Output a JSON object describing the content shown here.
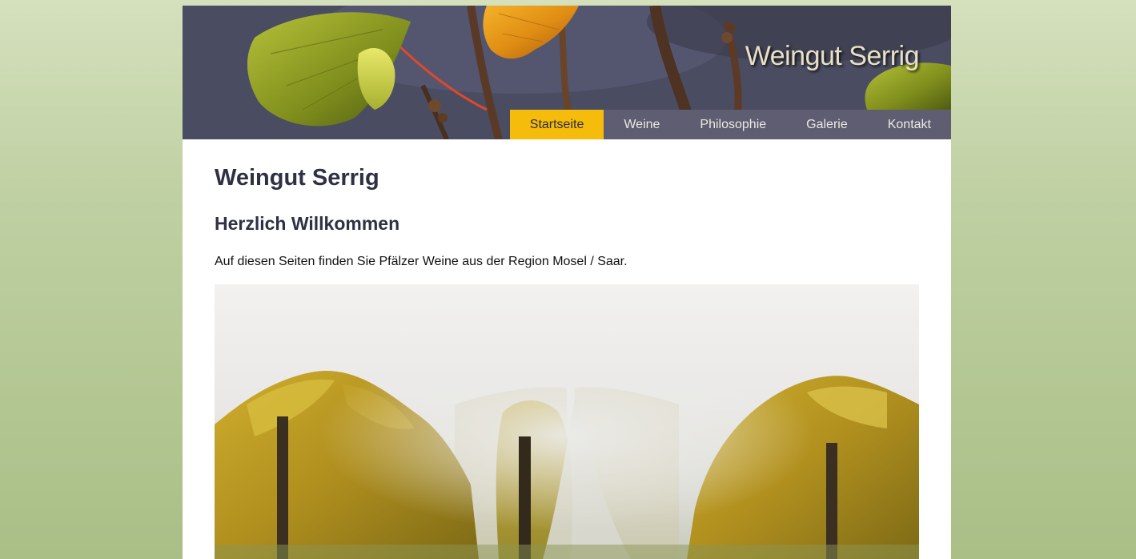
{
  "header": {
    "site_title": "Weingut Serrig",
    "banner_image": "autumn-vine-leaves-banner"
  },
  "nav": {
    "items": [
      {
        "label": "Startseite",
        "active": true
      },
      {
        "label": "Weine",
        "active": false
      },
      {
        "label": "Philosophie",
        "active": false
      },
      {
        "label": "Galerie",
        "active": false
      },
      {
        "label": "Kontakt",
        "active": false
      }
    ]
  },
  "main": {
    "title": "Weingut Serrig",
    "subtitle": "Herzlich Willkommen",
    "intro": "Auf diesen Seiten finden Sie Pfälzer Weine aus der Region Mosel / Saar.",
    "photo": "foggy-vineyard-rows"
  },
  "colors": {
    "nav_active": "#f6bc0b",
    "nav_background": "#5e5d72",
    "heading": "#2f3044",
    "page_background": "#bfd0a2"
  }
}
